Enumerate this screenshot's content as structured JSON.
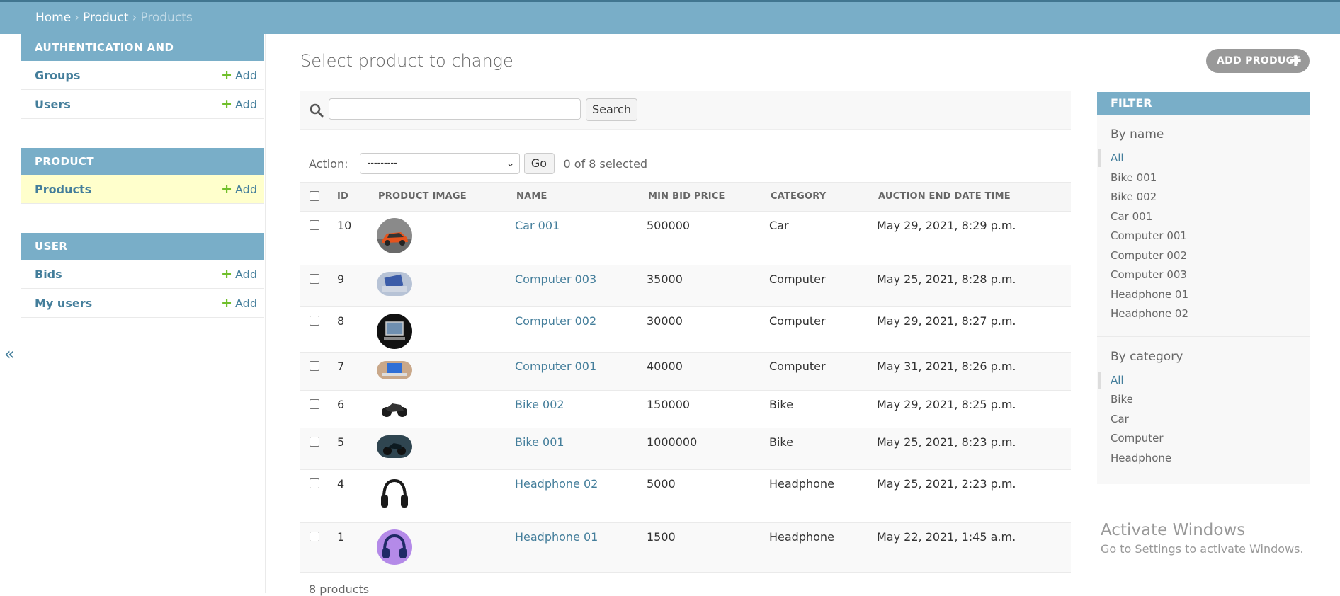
{
  "breadcrumb": {
    "home": "Home",
    "app": "Product",
    "current": "Products",
    "sep": "›"
  },
  "sidebar": {
    "collapse": "«",
    "modules": [
      {
        "caption": "AUTHENTICATION AND AUTHORIZATION",
        "rows": [
          {
            "label": "Groups",
            "add": "Add",
            "active": false
          },
          {
            "label": "Users",
            "add": "Add",
            "active": false
          }
        ]
      },
      {
        "caption": "PRODUCT",
        "rows": [
          {
            "label": "Products",
            "add": "Add",
            "active": true
          }
        ]
      },
      {
        "caption": "USER",
        "rows": [
          {
            "label": "Bids",
            "add": "Add",
            "active": false
          },
          {
            "label": "My users",
            "add": "Add",
            "active": false
          }
        ]
      }
    ]
  },
  "main": {
    "title": "Select product to change",
    "add_button": "ADD PRODUCT",
    "search": {
      "value": "",
      "button": "Search"
    },
    "action": {
      "label": "Action:",
      "selected": "---------",
      "go": "Go",
      "counter": "0 of 8 selected"
    },
    "columns": [
      "ID",
      "PRODUCT IMAGE",
      "NAME",
      "MIN BID PRICE",
      "CATEGORY",
      "AUCTION END DATE TIME"
    ],
    "rows": [
      {
        "id": "10",
        "name": "Car 001",
        "price": "500000",
        "category": "Car",
        "date": "May 29, 2021, 8:29 p.m.",
        "img": "car"
      },
      {
        "id": "9",
        "name": "Computer 003",
        "price": "35000",
        "category": "Computer",
        "date": "May 25, 2021, 8:28 p.m.",
        "img": "laptop-blue"
      },
      {
        "id": "8",
        "name": "Computer 002",
        "price": "30000",
        "category": "Computer",
        "date": "May 29, 2021, 8:27 p.m.",
        "img": "computer-dark"
      },
      {
        "id": "7",
        "name": "Computer 001",
        "price": "40000",
        "category": "Computer",
        "date": "May 31, 2021, 8:26 p.m.",
        "img": "laptop-warm"
      },
      {
        "id": "6",
        "name": "Bike 002",
        "price": "150000",
        "category": "Bike",
        "date": "May 29, 2021, 8:25 p.m.",
        "img": "bike-black"
      },
      {
        "id": "5",
        "name": "Bike 001",
        "price": "1000000",
        "category": "Bike",
        "date": "May 25, 2021, 8:23 p.m.",
        "img": "bike-teal"
      },
      {
        "id": "4",
        "name": "Headphone 02",
        "price": "5000",
        "category": "Headphone",
        "date": "May 25, 2021, 2:23 p.m.",
        "img": "headphone-black"
      },
      {
        "id": "1",
        "name": "Headphone 01",
        "price": "1500",
        "category": "Headphone",
        "date": "May 22, 2021, 1:45 a.m.",
        "img": "headphone-purple"
      }
    ],
    "footer": "8 products"
  },
  "filter": {
    "title": "FILTER",
    "groups": [
      {
        "heading": "By name",
        "items": [
          "All",
          "Bike 001",
          "Bike 002",
          "Car 001",
          "Computer 001",
          "Computer 002",
          "Computer 003",
          "Headphone 01",
          "Headphone 02"
        ]
      },
      {
        "heading": "By category",
        "items": [
          "All",
          "Bike",
          "Car",
          "Computer",
          "Headphone"
        ]
      }
    ]
  },
  "watermark": {
    "title": "Activate Windows",
    "subtitle": "Go to Settings to activate Windows."
  },
  "colors": {
    "header": "#79aec8",
    "link": "#447e9b",
    "add_green": "#70bf2b",
    "active_row": "#ffffcc"
  }
}
